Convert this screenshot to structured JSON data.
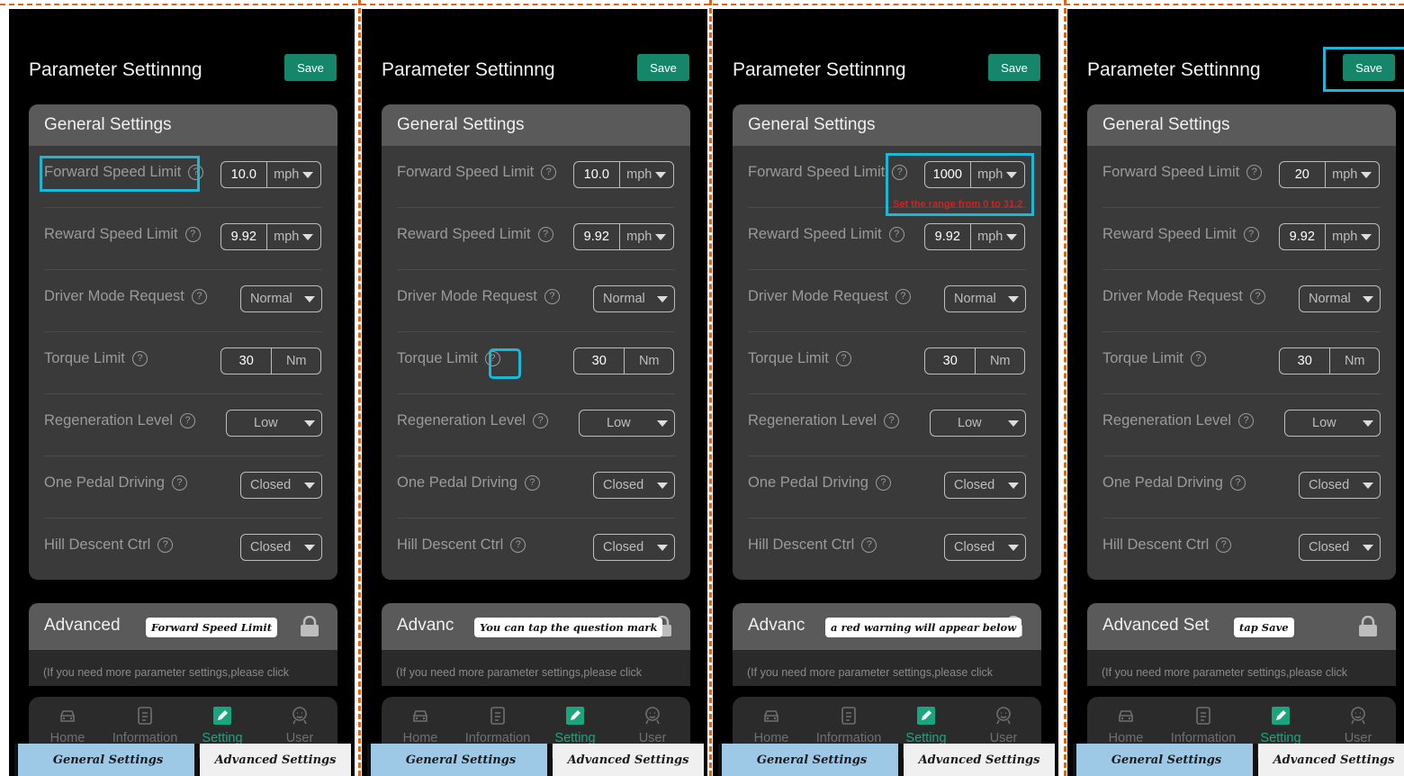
{
  "panels": [
    {
      "title": "Parameter Settinnng",
      "save": "Save",
      "general": "General Settings",
      "rows": {
        "fsl": "Forward Speed Limit",
        "fsl_val": "10.0",
        "fsl_unit": "mph",
        "rsl": "Reward Speed Limit",
        "rsl_val": "9.92",
        "rsl_unit": "mph",
        "dmr": "Driver Mode Request",
        "dmr_val": "Normal",
        "tl": "Torque Limit",
        "tl_val": "30",
        "tl_unit": "Nm",
        "rl": "Regeneration Level",
        "rl_val": "Low",
        "opd": "One Pedal Driving",
        "opd_val": "Closed",
        "hdc": "Hill Descent Ctrl",
        "hdc_val": "Closed"
      },
      "advanced": "Advanced",
      "note": "(If you need more parameter settings,please click",
      "bubble": "Forward Speed Limit"
    },
    {
      "title": "Parameter Settinnng",
      "save": "Save",
      "general": "General Settings",
      "rows": {
        "fsl": "Forward Speed Limit",
        "fsl_val": "10.0",
        "fsl_unit": "mph",
        "rsl": "Reward Speed Limit",
        "rsl_val": "9.92",
        "rsl_unit": "mph",
        "dmr": "Driver Mode Request",
        "dmr_val": "Normal",
        "tl": "Torque Limit",
        "tl_val": "30",
        "tl_unit": "Nm",
        "rl": "Regeneration Level",
        "rl_val": "Low",
        "opd": "One Pedal Driving",
        "opd_val": "Closed",
        "hdc": "Hill Descent Ctrl",
        "hdc_val": "Closed"
      },
      "advanced": "Advanc",
      "note": "(If you need more parameter settings,please click",
      "bubble": "You can tap the question mark"
    },
    {
      "title": "Parameter Settinnng",
      "save": "Save",
      "general": "General Settings",
      "rows": {
        "fsl": "Forward Speed Limit",
        "fsl_val": "1000",
        "fsl_unit": "mph",
        "rsl": "Reward Speed Limit",
        "rsl_val": "9.92",
        "rsl_unit": "mph",
        "dmr": "Driver Mode Request",
        "dmr_val": "Normal",
        "tl": "Torque Limit",
        "tl_val": "30",
        "tl_unit": "Nm",
        "rl": "Regeneration Level",
        "rl_val": "Low",
        "opd": "One Pedal Driving",
        "opd_val": "Closed",
        "hdc": "Hill Descent Ctrl",
        "hdc_val": "Closed"
      },
      "advanced": "Advanc",
      "note": "(If you need more parameter settings,please click",
      "bubble": "a red warning will appear below",
      "warning": "Set the range from 0 to 31.2"
    },
    {
      "title": "Parameter Settinnng",
      "save": "Save",
      "general": "General Settings",
      "rows": {
        "fsl": "Forward Speed Limit",
        "fsl_val": "20",
        "fsl_unit": "mph",
        "rsl": "Reward Speed Limit",
        "rsl_val": "9.92",
        "rsl_unit": "mph",
        "dmr": "Driver Mode Request",
        "dmr_val": "Normal",
        "tl": "Torque Limit",
        "tl_val": "30",
        "tl_unit": "Nm",
        "rl": "Regeneration Level",
        "rl_val": "Low",
        "opd": "One Pedal Driving",
        "opd_val": "Closed",
        "hdc": "Hill Descent Ctrl",
        "hdc_val": "Closed"
      },
      "advanced": "Advanced Set",
      "note": "(If you need more parameter settings,please click",
      "bubble": "tap Save"
    }
  ],
  "nav": {
    "home": "Home",
    "info": "Information",
    "setting": "Setting",
    "user": "User"
  },
  "tabs": {
    "general": "General Settings",
    "advanced": "Advanced Settings"
  },
  "colors": {
    "save": "#16866b",
    "active": "#19a67e",
    "highlight": "#1ab8d8",
    "warning": "#d32020"
  }
}
